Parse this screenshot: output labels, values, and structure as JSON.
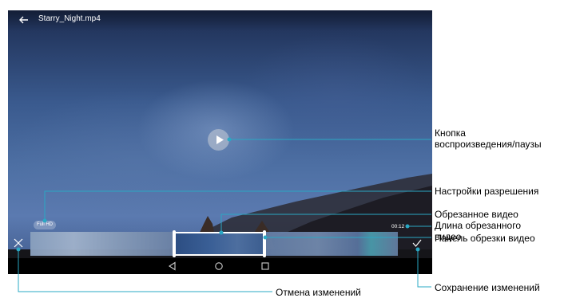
{
  "player": {
    "file_name": "Starry_Night.mp4",
    "resolution_badge": "Full HD",
    "trimmed_duration": "00:12"
  },
  "icons": {
    "back": "arrow-left-icon",
    "play": "play-icon",
    "cancel": "close-icon",
    "save": "checkmark-icon",
    "nav_back": "triangle-back-icon",
    "nav_home": "circle-home-icon",
    "nav_recent": "square-recent-icon"
  },
  "callouts": {
    "play_pause": [
      "Кнопка",
      "воспроизведения/паузы"
    ],
    "resolution": "Настройки разрешения",
    "trimmed_video": "Обрезанное видео",
    "trimmed_length": [
      "Длина обрезанного",
      "видео"
    ],
    "trim_panel": "Панель обрезки видео",
    "cancel": "Отмена изменений",
    "save": "Сохранение изменений"
  },
  "colors": {
    "callout_line": "#2aa8c4",
    "selection_frame": "#ffffff"
  }
}
